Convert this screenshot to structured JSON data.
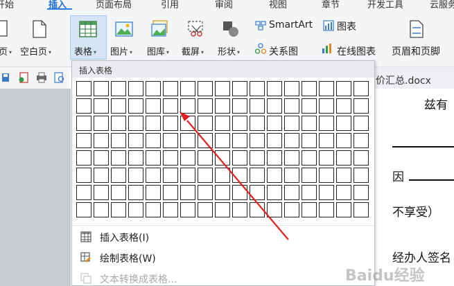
{
  "tabs": [
    {
      "label": "开始"
    },
    {
      "label": "插入",
      "active": true
    },
    {
      "label": "页面布局"
    },
    {
      "label": "引用"
    },
    {
      "label": "审阅"
    },
    {
      "label": "视图"
    },
    {
      "label": "章节"
    },
    {
      "label": "开发工具"
    },
    {
      "label": "云服务"
    }
  ],
  "ribbon": {
    "page_btn": "页",
    "blank_page": "空白页",
    "table": "表格",
    "picture": "图片",
    "gallery": "图库",
    "screenshot": "截屏",
    "shapes": "形状",
    "smartart": "SmartArt",
    "chart": "图表",
    "relation": "关系图",
    "online_chart": "在线图表",
    "header_footer": "页眉和页脚"
  },
  "doc_tab": "价汇总.docx",
  "document": {
    "line1": "兹有",
    "line2": "因",
    "line3": "不享受）",
    "line4": "经办人签名"
  },
  "dropdown": {
    "header": "插入表格",
    "grid_rows": 8,
    "grid_cols": 17,
    "items": [
      {
        "label": "插入表格(I)",
        "icon": "table-icon",
        "enabled": true
      },
      {
        "label": "绘制表格(W)",
        "icon": "pencil-table-icon",
        "enabled": true
      },
      {
        "label": "文本转换成表格...",
        "icon": "convert-table-icon",
        "enabled": false
      }
    ]
  },
  "annotation": {
    "color": "#e02020"
  },
  "watermark": "Baidu经验"
}
